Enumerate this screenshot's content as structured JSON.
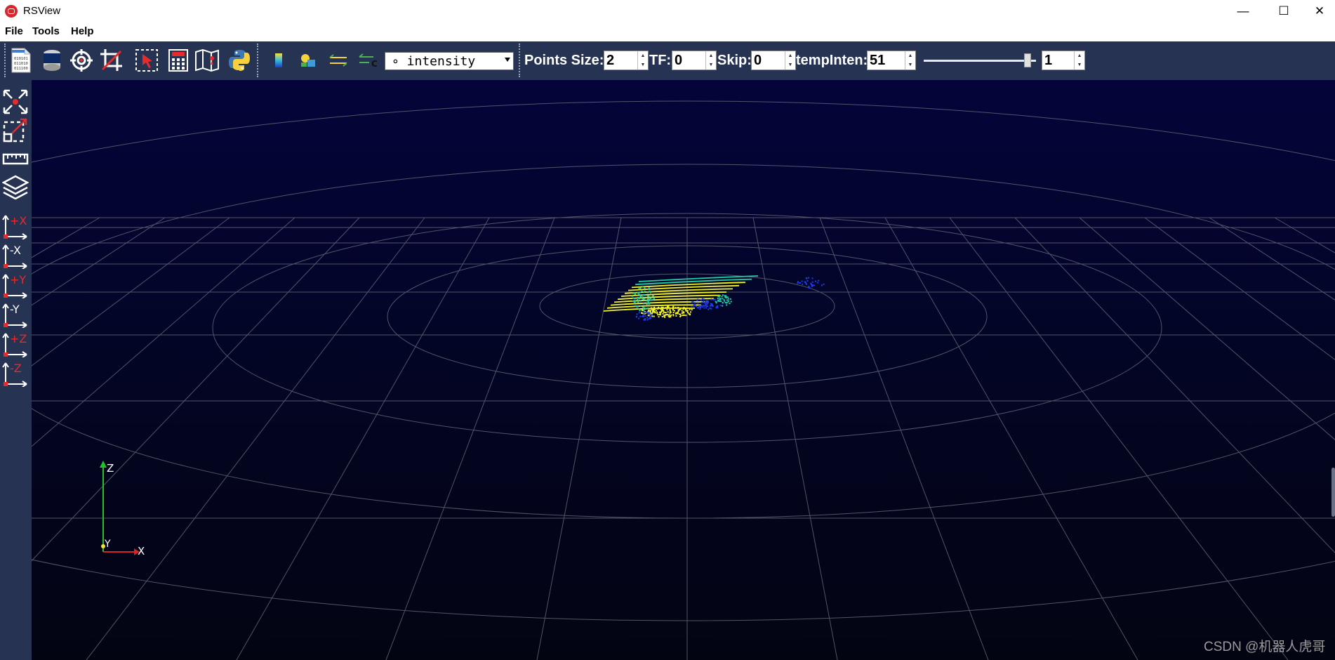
{
  "window": {
    "title": "RSView",
    "controls": {
      "minimize": "—",
      "maximize": "☐",
      "close": "✕"
    }
  },
  "menu": [
    "File",
    "Tools",
    "Help"
  ],
  "toolbar": {
    "file_icons": [
      "open-data-file-icon",
      "sensor-icon",
      "target-icon",
      "crop-icon",
      "select-points-icon",
      "calculator-icon",
      "map-icon",
      "python-icon"
    ],
    "color_icons": [
      "color-bar-icon",
      "color-shapes-icon",
      "arrows-icon",
      "arrows-c-icon"
    ],
    "color_mode": "∘ intensity",
    "points_size_label": "Points Size:",
    "points_size": "2",
    "tf_label": "TF:",
    "tf": "0",
    "skip_label": "Skip:",
    "skip": "0",
    "temp_inten_label": "tempInten:",
    "temp_inten": "51",
    "slider_level": 0.95,
    "slider_value": "1"
  },
  "sidebar": {
    "items": [
      {
        "name": "reset-camera-icon"
      },
      {
        "name": "zoom-to-box-icon"
      },
      {
        "name": "ruler-icon"
      },
      {
        "name": "layers-icon"
      },
      {
        "name": "view-plus-x",
        "axis": "+X"
      },
      {
        "name": "view-minus-x",
        "axis": "-X"
      },
      {
        "name": "view-plus-y",
        "axis": "+Y"
      },
      {
        "name": "view-minus-y",
        "axis": "-Y"
      },
      {
        "name": "view-plus-z",
        "axis": "+Z"
      },
      {
        "name": "view-minus-z",
        "axis": "-Z"
      }
    ]
  },
  "viewport": {
    "orientation_axes": {
      "z": "Z",
      "y": "Y",
      "x": "X"
    },
    "colors": {
      "grid": "#5e6473",
      "points_low": "#1e3cf0",
      "points_mid": "#1fd0a4",
      "points_high": "#f4f421"
    }
  },
  "watermark": "CSDN @机器人虎哥"
}
